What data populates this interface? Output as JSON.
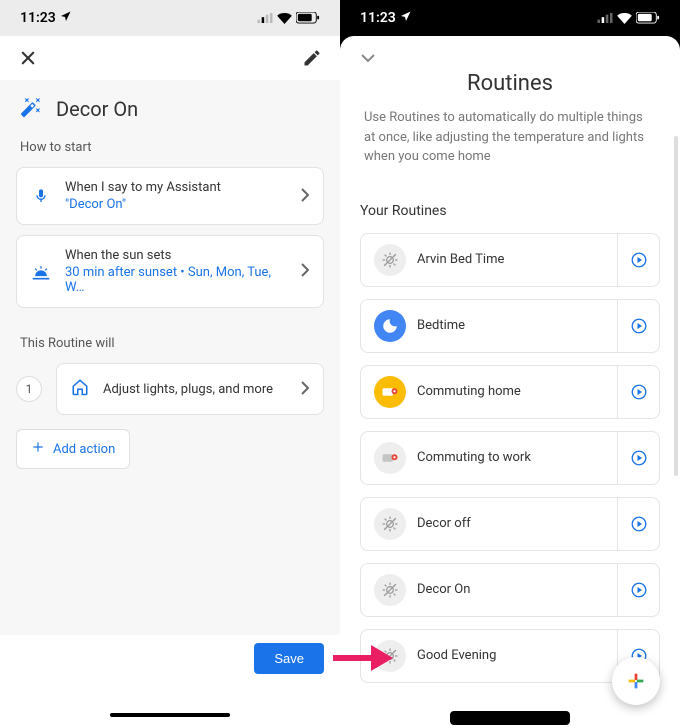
{
  "statusbar": {
    "time": "11:23"
  },
  "left": {
    "routine_title": "Decor On",
    "how_to_start": "How to start",
    "trigger1": {
      "title": "When I say to my Assistant",
      "sub": "\"Decor On\""
    },
    "trigger2": {
      "title": "When the sun sets",
      "sub": "30 min after sunset • Sun, Mon, Tue, W…"
    },
    "routine_will": "This Routine will",
    "step1_num": "1",
    "action1": "Adjust lights, plugs, and more",
    "add_action": "Add action",
    "save": "Save"
  },
  "right": {
    "title": "Routines",
    "desc": "Use Routines to automatically do multiple things at once, like adjusting the temperature and lights when you come home",
    "your_routines": "Your Routines",
    "items": [
      {
        "name": "Arvin Bed Time",
        "icon": "sun-off",
        "bg": "#eeeeee"
      },
      {
        "name": "Bedtime",
        "icon": "moon",
        "bg": "#4285f4"
      },
      {
        "name": "Commuting home",
        "icon": "commute",
        "bg": "#fbbc04"
      },
      {
        "name": "Commuting to work",
        "icon": "commute2",
        "bg": "#eeeeee"
      },
      {
        "name": "Decor off",
        "icon": "sun-off",
        "bg": "#eeeeee"
      },
      {
        "name": "Decor On",
        "icon": "sun-off",
        "bg": "#eeeeee"
      },
      {
        "name": "Good Evening",
        "icon": "sun-off",
        "bg": "#eeeeee"
      }
    ]
  }
}
